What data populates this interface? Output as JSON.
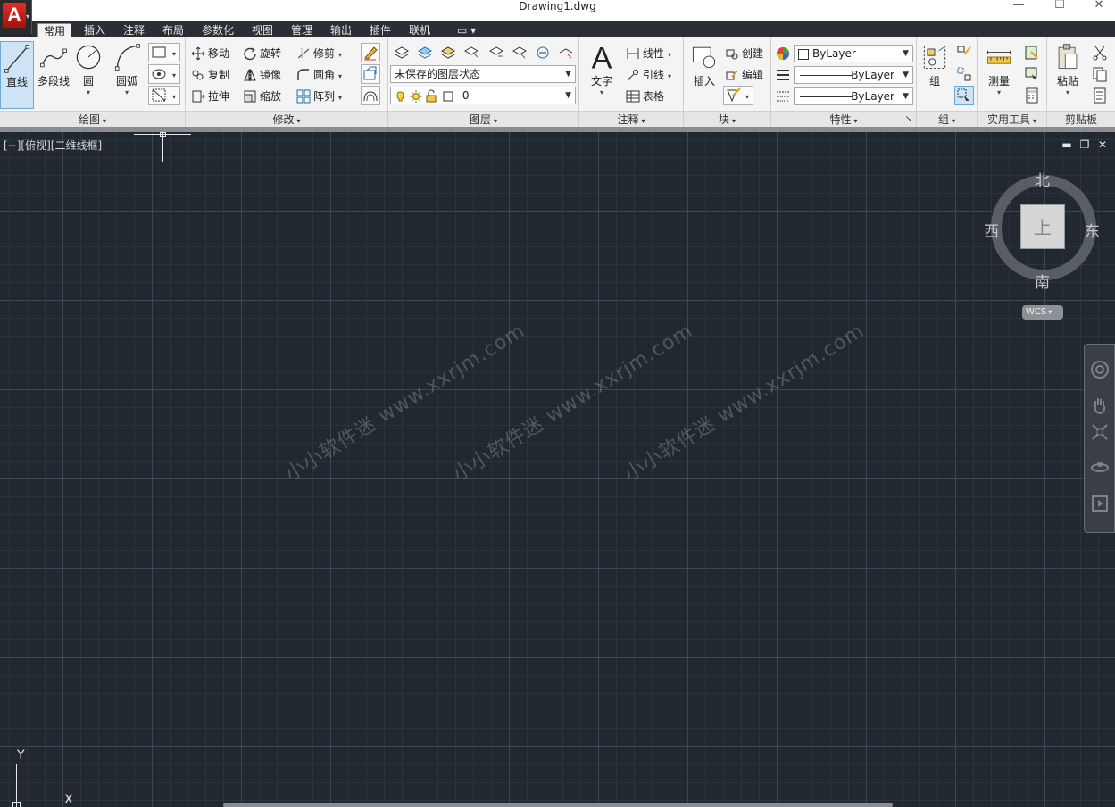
{
  "window": {
    "title": "Drawing1.dwg",
    "app_logo_letter": "A",
    "app_menu_caret": "▾",
    "controls": {
      "minimize": "—",
      "maximize": "☐",
      "close": "✕"
    }
  },
  "tabs": [
    {
      "label": "常用",
      "active": true
    },
    {
      "label": "插入"
    },
    {
      "label": "注释"
    },
    {
      "label": "布局"
    },
    {
      "label": "参数化"
    },
    {
      "label": "视图"
    },
    {
      "label": "管理"
    },
    {
      "label": "输出"
    },
    {
      "label": "插件"
    },
    {
      "label": "联机"
    },
    {
      "label": "▭ ▾"
    }
  ],
  "ribbon": {
    "draw": {
      "title": "绘图",
      "line": "直线",
      "polyline": "多段线",
      "circle": "圆",
      "arc": "圆弧"
    },
    "modify": {
      "title": "修改",
      "move": "移动",
      "rotate": "旋转",
      "trim": "修剪",
      "copy": "复制",
      "mirror": "镜像",
      "fillet": "圆角",
      "stretch": "拉伸",
      "scale": "缩放",
      "array": "阵列"
    },
    "layers": {
      "title": "图层",
      "layer_state": "未保存的图层状态",
      "current_layer": "0"
    },
    "annotation": {
      "title": "注释",
      "text": "文字",
      "linetype": "线性",
      "leader": "引线",
      "table": "表格"
    },
    "block": {
      "title": "块",
      "insert": "插入",
      "create": "创建",
      "edit": "编辑"
    },
    "properties": {
      "title": "特性",
      "color": "ByLayer",
      "lineweight": "ByLayer",
      "linetype": "ByLayer",
      "launcher": "↘"
    },
    "groups": {
      "title": "组",
      "group": "组"
    },
    "utilities": {
      "title": "实用工具",
      "measure": "测量"
    },
    "clipboard": {
      "title": "剪贴板",
      "paste": "粘贴"
    }
  },
  "viewport": {
    "label": "[−][俯视][二维线框]",
    "controls": {
      "minimize": "▬",
      "restore": "❐",
      "close": "✕"
    }
  },
  "viewcube": {
    "north": "北",
    "south": "南",
    "east": "东",
    "west": "西",
    "face": "上",
    "wcs": "WCS"
  },
  "ucs": {
    "y": "Y",
    "x": "X"
  },
  "watermarks": [
    "小小软件迷 www.xxrjm.com",
    "小小软件迷 www.xxrjm.com",
    "小小软件迷 www.xxrjm.com"
  ],
  "colors": {
    "canvas_bg": "#212830",
    "ribbon_bg": "#f4f4f4",
    "tabstrip_bg": "#2a2f36",
    "selected_tool": "#cfe3f6",
    "logo_red": "#e52d27"
  }
}
